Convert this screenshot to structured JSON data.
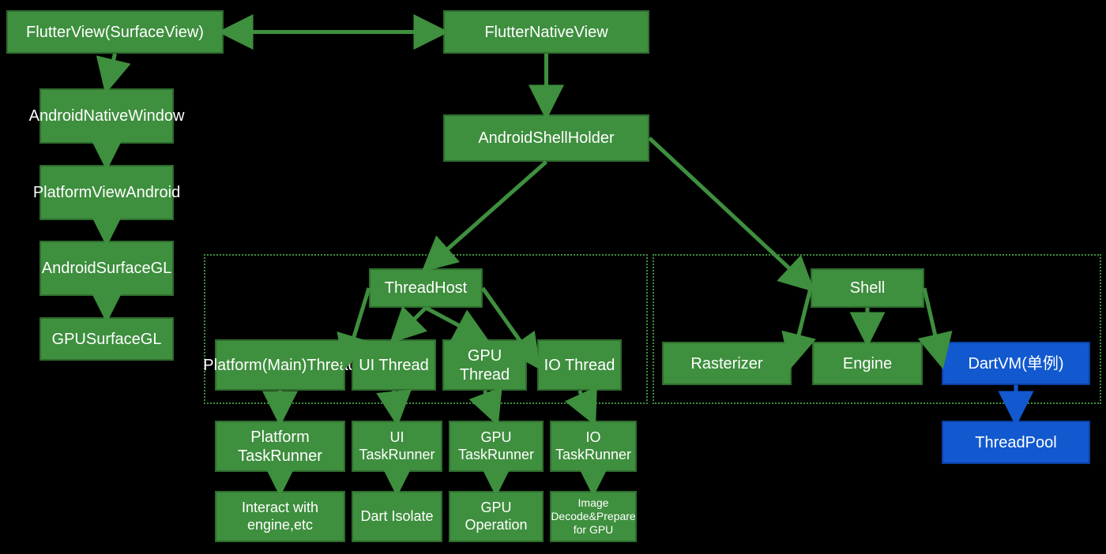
{
  "colors": {
    "green": "#3e8f3e",
    "greenBorder": "#2e6b2e",
    "blue": "#1259cf",
    "blueBorder": "#0b3ea1"
  },
  "nodes": {
    "flutterView": {
      "label": "FlutterView(SurfaceView)"
    },
    "androidNativeWindow": {
      "label": "AndroidNativeWindow"
    },
    "platformViewAndroid": {
      "label": "PlatformViewAndroid"
    },
    "androidSurfaceGL": {
      "label": "AndroidSurfaceGL"
    },
    "gpuSurfaceGL": {
      "label": "GPUSurfaceGL"
    },
    "flutterNativeView": {
      "label": "FlutterNativeView"
    },
    "androidShellHolder": {
      "label": "AndroidShellHolder"
    },
    "threadHost": {
      "label": "ThreadHost"
    },
    "platformMainThread": {
      "label": "Platform(Main)Thread"
    },
    "uiThread": {
      "label": "UI Thread"
    },
    "gpuThread": {
      "label": "GPU Thread"
    },
    "ioThread": {
      "label": "IO Thread"
    },
    "platformTaskRunner": {
      "label": "Platform TaskRunner"
    },
    "uiTaskRunner": {
      "label": "UI TaskRunner"
    },
    "gpuTaskRunner": {
      "label": "GPU TaskRunner"
    },
    "ioTaskRunner": {
      "label": "IO TaskRunner"
    },
    "interactEngine": {
      "label": "Interact with engine,etc"
    },
    "dartIsolate": {
      "label": "Dart Isolate"
    },
    "gpuOperation": {
      "label": "GPU Operation"
    },
    "imageDecode": {
      "label": "Image Decode&Prepare for GPU"
    },
    "shell": {
      "label": "Shell"
    },
    "rasterizer": {
      "label": "Rasterizer"
    },
    "engine": {
      "label": "Engine"
    },
    "dartVM": {
      "label": "DartVM(单例)"
    },
    "threadPool": {
      "label": "ThreadPool"
    }
  },
  "edges": [
    {
      "from": "flutterView",
      "to": "flutterNativeView",
      "bidir": true
    },
    {
      "from": "flutterView",
      "to": "androidNativeWindow"
    },
    {
      "from": "androidNativeWindow",
      "to": "platformViewAndroid"
    },
    {
      "from": "platformViewAndroid",
      "to": "androidSurfaceGL"
    },
    {
      "from": "androidSurfaceGL",
      "to": "gpuSurfaceGL"
    },
    {
      "from": "flutterNativeView",
      "to": "androidShellHolder"
    },
    {
      "from": "androidShellHolder",
      "to": "threadHost"
    },
    {
      "from": "androidShellHolder",
      "to": "shell"
    },
    {
      "from": "threadHost",
      "to": "platformMainThread"
    },
    {
      "from": "threadHost",
      "to": "uiThread"
    },
    {
      "from": "threadHost",
      "to": "gpuThread"
    },
    {
      "from": "threadHost",
      "to": "ioThread"
    },
    {
      "from": "platformMainThread",
      "to": "platformTaskRunner"
    },
    {
      "from": "uiThread",
      "to": "uiTaskRunner"
    },
    {
      "from": "gpuThread",
      "to": "gpuTaskRunner"
    },
    {
      "from": "ioThread",
      "to": "ioTaskRunner"
    },
    {
      "from": "platformTaskRunner",
      "to": "interactEngine"
    },
    {
      "from": "uiTaskRunner",
      "to": "dartIsolate"
    },
    {
      "from": "gpuTaskRunner",
      "to": "gpuOperation"
    },
    {
      "from": "ioTaskRunner",
      "to": "imageDecode"
    },
    {
      "from": "shell",
      "to": "rasterizer"
    },
    {
      "from": "shell",
      "to": "engine"
    },
    {
      "from": "shell",
      "to": "dartVM"
    },
    {
      "from": "dartVM",
      "to": "threadPool"
    }
  ],
  "groups": {
    "threadHostGroup": {
      "contains": [
        "threadHost",
        "platformMainThread",
        "uiThread",
        "gpuThread",
        "ioThread"
      ]
    },
    "shellGroup": {
      "contains": [
        "shell",
        "rasterizer",
        "engine",
        "dartVM"
      ]
    }
  }
}
